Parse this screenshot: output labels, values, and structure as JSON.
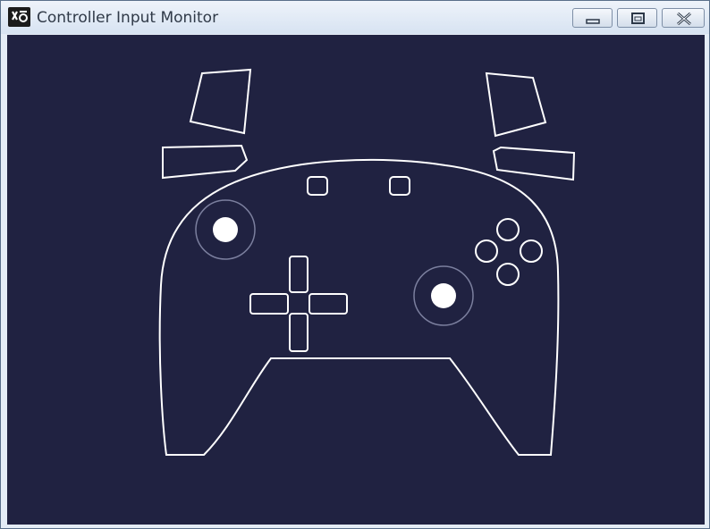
{
  "window": {
    "title": "Controller Input Monitor",
    "icon": "controller-app-icon",
    "controls": [
      "minimize-icon",
      "maximize-icon",
      "close-icon"
    ]
  },
  "canvas": {
    "background": "#202241",
    "outline_color": "#ffffff",
    "stick_ring_color": "#7b7f9e"
  }
}
